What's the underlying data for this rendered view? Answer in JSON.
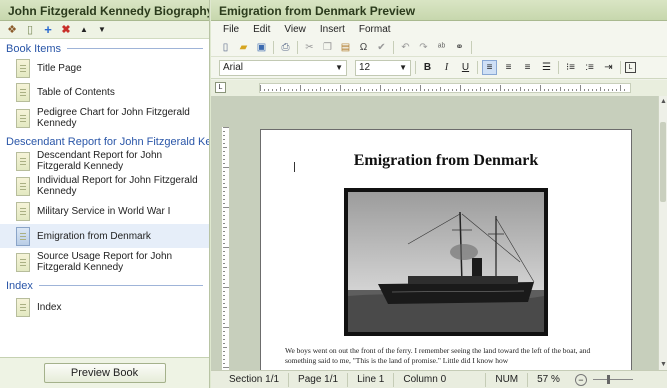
{
  "left_panel": {
    "title": "John Fitzgerald Kennedy Biography",
    "sections": [
      {
        "label": "Book Items",
        "items": [
          {
            "label": "Title Page"
          },
          {
            "label": "Table of Contents"
          },
          {
            "label": "Pedigree Chart for John Fitzgerald Kennedy"
          }
        ]
      },
      {
        "label": "Descendant Report for John Fitzgerald Ke...",
        "items": [
          {
            "label": "Descendant Report for John Fitzgerald Kennedy"
          },
          {
            "label": "Individual Report for John Fitzgerald Kennedy"
          },
          {
            "label": "Military Service in World War I"
          },
          {
            "label": "Emigration from Denmark",
            "selected": true
          },
          {
            "label": "Source Usage Report for John Fitzgerald Kennedy"
          }
        ]
      },
      {
        "label": "Index",
        "items": [
          {
            "label": "Index"
          }
        ]
      }
    ],
    "preview_button": "Preview Book"
  },
  "right_panel": {
    "title": "Emigration from Denmark Preview",
    "menu": [
      "File",
      "Edit",
      "View",
      "Insert",
      "Format"
    ],
    "font_name": "Arial",
    "font_size": "12",
    "document": {
      "heading": "Emigration from Denmark",
      "body": "We boys went on out the front of the ferry. I remember seeing the land toward the left of the boat, and something said to me, \"This is the land of promise.\" Little did I know how"
    },
    "status": {
      "section": "Section 1/1",
      "page": "Page 1/1",
      "line": "Line 1",
      "column": "Column 0",
      "num": "NUM",
      "zoom": "57 %"
    }
  },
  "colors": {
    "title_bar": "#c7d7ad",
    "section_link": "#2a56a8",
    "selected_item": "#e6eef9"
  }
}
